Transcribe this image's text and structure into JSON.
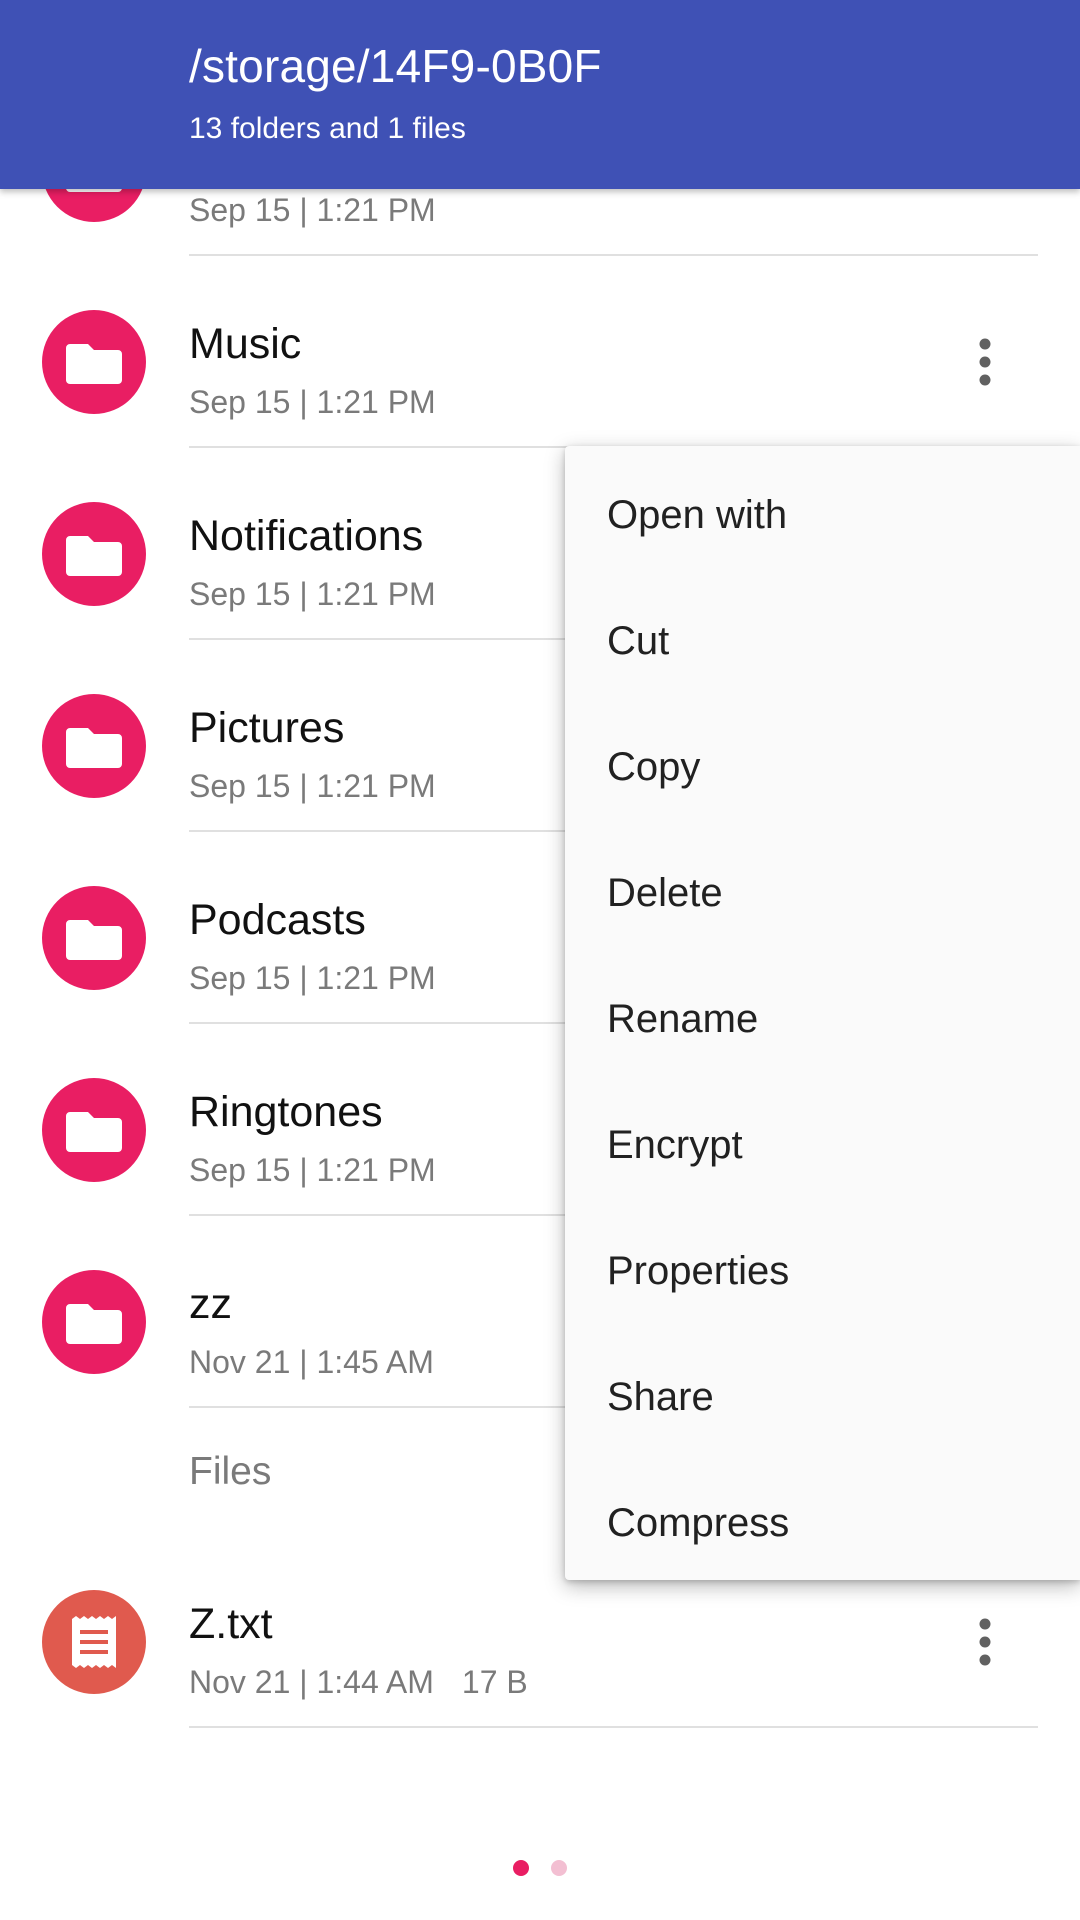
{
  "header": {
    "path": "/storage/14F9-0B0F",
    "summary": "13 folders and 1 files"
  },
  "folders": [
    {
      "name": "",
      "date": "Sep 15 | 1:21 PM"
    },
    {
      "name": "Music",
      "date": "Sep 15 | 1:21 PM"
    },
    {
      "name": "Notifications",
      "date": "Sep 15 | 1:21 PM"
    },
    {
      "name": "Pictures",
      "date": "Sep 15 | 1:21 PM"
    },
    {
      "name": "Podcasts",
      "date": "Sep 15 | 1:21 PM"
    },
    {
      "name": "Ringtones",
      "date": "Sep 15 | 1:21 PM"
    },
    {
      "name": "zz",
      "date": "Nov 21 | 1:45 AM"
    }
  ],
  "files_label": "Files",
  "files": [
    {
      "name": "Z.txt",
      "date": "Nov 21 | 1:44 AM",
      "size": "17 B"
    }
  ],
  "context_menu": {
    "items": [
      "Open with",
      "Cut",
      "Copy",
      "Delete",
      "Rename",
      "Encrypt",
      "Properties",
      "Share",
      "Compress"
    ]
  },
  "pager": {
    "pages": 2,
    "active": 1
  },
  "icons": {
    "folder": "folder-icon",
    "file": "text-file-icon",
    "more": "more-vert-icon"
  },
  "colors": {
    "appbar": "#3F51B5",
    "folder_avatar": "#E91E63",
    "file_avatar": "#E05A4E",
    "pager_active": "#E91E63",
    "pager_inactive": "#F3BFD2"
  }
}
